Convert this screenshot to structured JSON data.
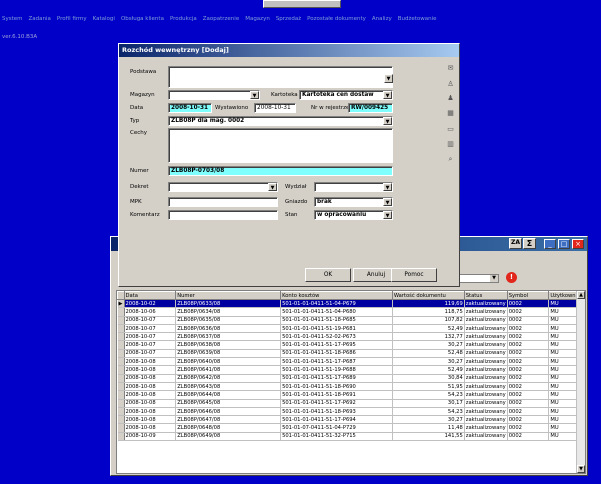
{
  "menu": [
    "System",
    "Zadania",
    "Profil firmy",
    "Katalogi",
    "Obsługa klienta",
    "Produkcja",
    "Zaopatrzenie",
    "Magazyn",
    "Sprzedaż",
    "Pozostałe dokumenty",
    "Analizy",
    "Budżetowanie"
  ],
  "version": "ver.6.10.B3A",
  "dialog": {
    "title": "Rozchód wewnętrzny [Dodaj]",
    "podstawa_label": "Podstawa",
    "podstawa_value": "",
    "magazyn_label": "Magazyn",
    "magazyn_value": "",
    "kartoteka_label": "Kartoteka",
    "kartoteka_value": "Kartoteka cen dostaw",
    "data_label": "Data",
    "data_value": "2008-10-31",
    "wystawiono_label": "Wystawiono",
    "wystawiono_value": "2008-10-31",
    "nr_label": "Nr w rejestrze",
    "nr_value": "RW/009425",
    "typ_label": "Typ",
    "typ_value": "ZLB08P dla mag. 0002",
    "cechy_label": "Cechy",
    "numer_label": "Numer",
    "numer_value": "ZLB08P-0703/08",
    "dekret_label": "Dekret",
    "wydzial_label": "Wydział",
    "mpk_label": "MPK",
    "gniazdo_label": "Gniazdo",
    "gniazdo_value": "brak",
    "komentarz_label": "Komentarz",
    "stan_label": "Stan",
    "stan_value": "w opracowaniu",
    "ok_label": "OK",
    "anuluj_label": "Anuluj",
    "pomoc_label": "Pomoc"
  },
  "list": {
    "sort_label": "ZA",
    "sigma_label": "Σ",
    "columns": [
      "Data",
      "Numer",
      "Konto kosztów",
      "Wartość dokumentu",
      "Status",
      "Symbol",
      "Użytkownik"
    ],
    "rows": [
      [
        "2008-10-02",
        "ZLB08P/0633/08",
        "501-01-01-0411-51-04-P679",
        "119,69",
        "zaktualizowany",
        "0002",
        "MU"
      ],
      [
        "2008-10-06",
        "ZLB08P/0634/08",
        "501-01-01-0411-51-04-P680",
        "118,75",
        "zaktualizowany",
        "0002",
        "MU"
      ],
      [
        "2008-10-07",
        "ZLB08P/0635/08",
        "501-01-01-0411-51-18-P685",
        "107,82",
        "zaktualizowany",
        "0002",
        "MU"
      ],
      [
        "2008-10-07",
        "ZLB08P/0636/08",
        "501-01-01-0411-51-19-P681",
        "52,49",
        "zaktualizowany",
        "0002",
        "MU"
      ],
      [
        "2008-10-07",
        "ZLB08P/0637/08",
        "501-01-01-0411-52-02-P673",
        "132,77",
        "zaktualizowany",
        "0002",
        "MU"
      ],
      [
        "2008-10-07",
        "ZLB08P/0638/08",
        "501-01-01-0411-51-17-P695",
        "30,27",
        "zaktualizowany",
        "0002",
        "MU"
      ],
      [
        "2008-10-07",
        "ZLB08P/0639/08",
        "501-01-01-0411-51-18-P686",
        "52,48",
        "zaktualizowany",
        "0002",
        "MU"
      ],
      [
        "2008-10-08",
        "ZLB08P/0640/08",
        "501-01-01-0411-51-17-P687",
        "30,27",
        "zaktualizowany",
        "0002",
        "MU"
      ],
      [
        "2008-10-08",
        "ZLB08P/0641/08",
        "501-01-01-0411-51-19-P688",
        "52,49",
        "zaktualizowany",
        "0002",
        "MU"
      ],
      [
        "2008-10-08",
        "ZLB08P/0642/08",
        "501-01-01-0411-51-17-P689",
        "30,84",
        "zaktualizowany",
        "0002",
        "MU"
      ],
      [
        "2008-10-08",
        "ZLB08P/0643/08",
        "501-01-01-0411-51-18-P690",
        "51,95",
        "zaktualizowany",
        "0002",
        "MU"
      ],
      [
        "2008-10-08",
        "ZLB08P/0644/08",
        "501-01-01-0411-51-18-P691",
        "54,23",
        "zaktualizowany",
        "0002",
        "MU"
      ],
      [
        "2008-10-08",
        "ZLB08P/0645/08",
        "501-01-01-0411-51-17-P692",
        "30,17",
        "zaktualizowany",
        "0002",
        "MU"
      ],
      [
        "2008-10-08",
        "ZLB08P/0646/08",
        "501-01-01-0411-51-18-P693",
        "54,23",
        "zaktualizowany",
        "0002",
        "MU"
      ],
      [
        "2008-10-08",
        "ZLB08P/0647/08",
        "501-01-01-0411-51-17-P694",
        "30,27",
        "zaktualizowany",
        "0002",
        "MU"
      ],
      [
        "2008-10-08",
        "ZLB08P/0648/08",
        "501-01-07-0411-51-04-P729",
        "11,48",
        "zaktualizowany",
        "0002",
        "MU"
      ],
      [
        "2008-10-09",
        "ZLB08P/0649/08",
        "501-01-01-0411-51-32-P715",
        "141,55",
        "zaktualizowany",
        "0002",
        "MU"
      ]
    ]
  },
  "colors": {
    "desktop": "#0000c8",
    "selection": "#0000a0",
    "highlight": "#80ffff"
  },
  "icons": [
    "envelope-icon",
    "person-icon",
    "people-icon",
    "calendar-icon",
    "folders-icon",
    "chart-icon",
    "search-icon"
  ]
}
